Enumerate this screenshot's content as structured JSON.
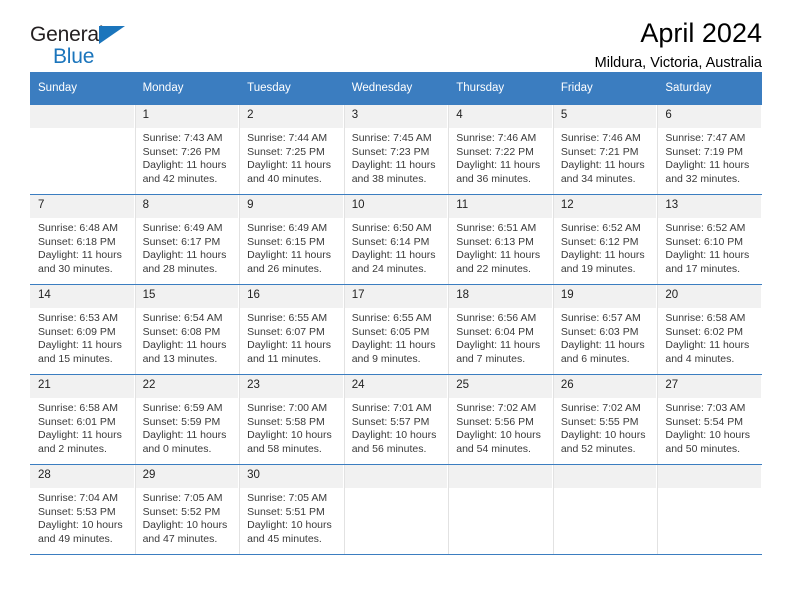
{
  "brand": {
    "name_top": "General",
    "name_bottom": "Blue",
    "triangle_icon": "blue-triangle-icon",
    "accent_color": "#1b75bc"
  },
  "header": {
    "month_title": "April 2024",
    "location": "Mildura, Victoria, Australia"
  },
  "calendar": {
    "header_color": "#3b7dc0",
    "weekday_headers": [
      "Sunday",
      "Monday",
      "Tuesday",
      "Wednesday",
      "Thursday",
      "Friday",
      "Saturday"
    ],
    "weeks": [
      [
        {
          "day": "",
          "lines": []
        },
        {
          "day": "1",
          "lines": [
            "Sunrise: 7:43 AM",
            "Sunset: 7:26 PM",
            "Daylight: 11 hours",
            "and 42 minutes."
          ]
        },
        {
          "day": "2",
          "lines": [
            "Sunrise: 7:44 AM",
            "Sunset: 7:25 PM",
            "Daylight: 11 hours",
            "and 40 minutes."
          ]
        },
        {
          "day": "3",
          "lines": [
            "Sunrise: 7:45 AM",
            "Sunset: 7:23 PM",
            "Daylight: 11 hours",
            "and 38 minutes."
          ]
        },
        {
          "day": "4",
          "lines": [
            "Sunrise: 7:46 AM",
            "Sunset: 7:22 PM",
            "Daylight: 11 hours",
            "and 36 minutes."
          ]
        },
        {
          "day": "5",
          "lines": [
            "Sunrise: 7:46 AM",
            "Sunset: 7:21 PM",
            "Daylight: 11 hours",
            "and 34 minutes."
          ]
        },
        {
          "day": "6",
          "lines": [
            "Sunrise: 7:47 AM",
            "Sunset: 7:19 PM",
            "Daylight: 11 hours",
            "and 32 minutes."
          ]
        }
      ],
      [
        {
          "day": "7",
          "lines": [
            "Sunrise: 6:48 AM",
            "Sunset: 6:18 PM",
            "Daylight: 11 hours",
            "and 30 minutes."
          ]
        },
        {
          "day": "8",
          "lines": [
            "Sunrise: 6:49 AM",
            "Sunset: 6:17 PM",
            "Daylight: 11 hours",
            "and 28 minutes."
          ]
        },
        {
          "day": "9",
          "lines": [
            "Sunrise: 6:49 AM",
            "Sunset: 6:15 PM",
            "Daylight: 11 hours",
            "and 26 minutes."
          ]
        },
        {
          "day": "10",
          "lines": [
            "Sunrise: 6:50 AM",
            "Sunset: 6:14 PM",
            "Daylight: 11 hours",
            "and 24 minutes."
          ]
        },
        {
          "day": "11",
          "lines": [
            "Sunrise: 6:51 AM",
            "Sunset: 6:13 PM",
            "Daylight: 11 hours",
            "and 22 minutes."
          ]
        },
        {
          "day": "12",
          "lines": [
            "Sunrise: 6:52 AM",
            "Sunset: 6:12 PM",
            "Daylight: 11 hours",
            "and 19 minutes."
          ]
        },
        {
          "day": "13",
          "lines": [
            "Sunrise: 6:52 AM",
            "Sunset: 6:10 PM",
            "Daylight: 11 hours",
            "and 17 minutes."
          ]
        }
      ],
      [
        {
          "day": "14",
          "lines": [
            "Sunrise: 6:53 AM",
            "Sunset: 6:09 PM",
            "Daylight: 11 hours",
            "and 15 minutes."
          ]
        },
        {
          "day": "15",
          "lines": [
            "Sunrise: 6:54 AM",
            "Sunset: 6:08 PM",
            "Daylight: 11 hours",
            "and 13 minutes."
          ]
        },
        {
          "day": "16",
          "lines": [
            "Sunrise: 6:55 AM",
            "Sunset: 6:07 PM",
            "Daylight: 11 hours",
            "and 11 minutes."
          ]
        },
        {
          "day": "17",
          "lines": [
            "Sunrise: 6:55 AM",
            "Sunset: 6:05 PM",
            "Daylight: 11 hours",
            "and 9 minutes."
          ]
        },
        {
          "day": "18",
          "lines": [
            "Sunrise: 6:56 AM",
            "Sunset: 6:04 PM",
            "Daylight: 11 hours",
            "and 7 minutes."
          ]
        },
        {
          "day": "19",
          "lines": [
            "Sunrise: 6:57 AM",
            "Sunset: 6:03 PM",
            "Daylight: 11 hours",
            "and 6 minutes."
          ]
        },
        {
          "day": "20",
          "lines": [
            "Sunrise: 6:58 AM",
            "Sunset: 6:02 PM",
            "Daylight: 11 hours",
            "and 4 minutes."
          ]
        }
      ],
      [
        {
          "day": "21",
          "lines": [
            "Sunrise: 6:58 AM",
            "Sunset: 6:01 PM",
            "Daylight: 11 hours",
            "and 2 minutes."
          ]
        },
        {
          "day": "22",
          "lines": [
            "Sunrise: 6:59 AM",
            "Sunset: 5:59 PM",
            "Daylight: 11 hours",
            "and 0 minutes."
          ]
        },
        {
          "day": "23",
          "lines": [
            "Sunrise: 7:00 AM",
            "Sunset: 5:58 PM",
            "Daylight: 10 hours",
            "and 58 minutes."
          ]
        },
        {
          "day": "24",
          "lines": [
            "Sunrise: 7:01 AM",
            "Sunset: 5:57 PM",
            "Daylight: 10 hours",
            "and 56 minutes."
          ]
        },
        {
          "day": "25",
          "lines": [
            "Sunrise: 7:02 AM",
            "Sunset: 5:56 PM",
            "Daylight: 10 hours",
            "and 54 minutes."
          ]
        },
        {
          "day": "26",
          "lines": [
            "Sunrise: 7:02 AM",
            "Sunset: 5:55 PM",
            "Daylight: 10 hours",
            "and 52 minutes."
          ]
        },
        {
          "day": "27",
          "lines": [
            "Sunrise: 7:03 AM",
            "Sunset: 5:54 PM",
            "Daylight: 10 hours",
            "and 50 minutes."
          ]
        }
      ],
      [
        {
          "day": "28",
          "lines": [
            "Sunrise: 7:04 AM",
            "Sunset: 5:53 PM",
            "Daylight: 10 hours",
            "and 49 minutes."
          ]
        },
        {
          "day": "29",
          "lines": [
            "Sunrise: 7:05 AM",
            "Sunset: 5:52 PM",
            "Daylight: 10 hours",
            "and 47 minutes."
          ]
        },
        {
          "day": "30",
          "lines": [
            "Sunrise: 7:05 AM",
            "Sunset: 5:51 PM",
            "Daylight: 10 hours",
            "and 45 minutes."
          ]
        },
        {
          "day": "",
          "lines": []
        },
        {
          "day": "",
          "lines": []
        },
        {
          "day": "",
          "lines": []
        },
        {
          "day": "",
          "lines": []
        }
      ]
    ]
  }
}
